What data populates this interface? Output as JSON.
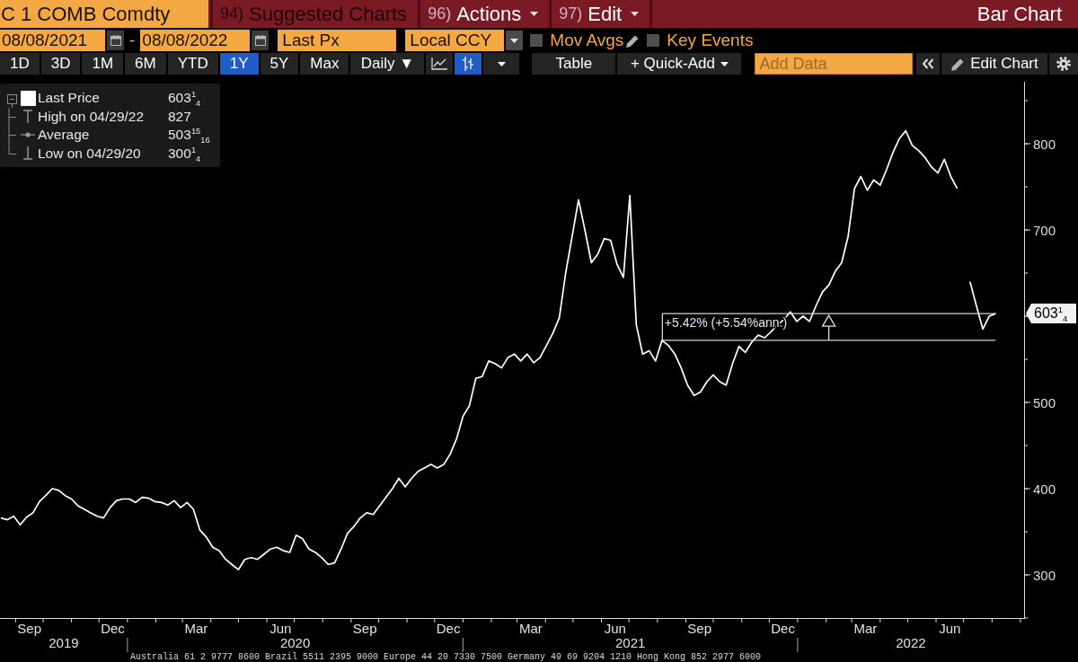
{
  "header": {
    "security": "C 1 COMB Comdty",
    "menus": [
      {
        "number": "94)",
        "label": "Suggested Charts",
        "disabled": true,
        "has_menu": false
      },
      {
        "number": "96)",
        "label": "Actions",
        "disabled": false,
        "has_menu": true
      },
      {
        "number": "97)",
        "label": "Edit",
        "disabled": false,
        "has_menu": true
      }
    ],
    "title": "Bar Chart"
  },
  "settings_bar": {
    "start_date": "08/08/2021",
    "date_separator": "-",
    "end_date": "08/08/2022",
    "field": "Last Px",
    "currency": "Local CCY",
    "toggles": [
      {
        "label": "Mov Avgs",
        "checked": false,
        "editable": true
      },
      {
        "label": "Key Events",
        "checked": false,
        "editable": false
      }
    ]
  },
  "toolbar": {
    "periods": [
      {
        "label": "1D",
        "selected": false
      },
      {
        "label": "3D",
        "selected": false
      },
      {
        "label": "1M",
        "selected": false
      },
      {
        "label": "6M",
        "selected": false
      },
      {
        "label": "YTD",
        "selected": false
      },
      {
        "label": "1Y",
        "selected": true
      },
      {
        "label": "5Y",
        "selected": false
      },
      {
        "label": "Max",
        "selected": false
      }
    ],
    "frequency": "Daily ▼",
    "chart_styles": [
      {
        "kind": "line",
        "selected": false
      },
      {
        "kind": "bar",
        "selected": true
      }
    ],
    "table_button": "Table",
    "quick_add": "+ Quick-Add",
    "add_data": {
      "placeholder": "Add Data"
    },
    "edit_chart": "Edit Chart"
  },
  "chart": {
    "legend": {
      "expanded": true,
      "items": [
        {
          "kind": "series",
          "label": "Last Price",
          "value": "603$^{1}$$_{4}$"
        },
        {
          "kind": "high",
          "label": "High on 04/29/22",
          "value": "827"
        },
        {
          "kind": "average",
          "label": "Average",
          "value": "503$^{15}$$_{16}$"
        },
        {
          "kind": "low",
          "label": "Low on 04/29/20",
          "value": "300$^{1}$$_{4}$"
        }
      ]
    },
    "last_price_tag": "603$^{1}$$_{4}$",
    "year_labels": [
      "2019",
      "2020",
      "2021",
      "2022"
    ],
    "chart_data": {
      "type": "line",
      "x": [
        "2019-08-16",
        "2019-08-23",
        "2019-08-30",
        "2019-09-06",
        "2019-09-13",
        "2019-09-20",
        "2019-09-27",
        "2019-10-04",
        "2019-10-11",
        "2019-10-18",
        "2019-10-25",
        "2019-11-01",
        "2019-11-08",
        "2019-11-15",
        "2019-11-22",
        "2019-11-29",
        "2019-12-06",
        "2019-12-13",
        "2019-12-20",
        "2019-12-27",
        "2020-01-03",
        "2020-01-10",
        "2020-01-17",
        "2020-01-24",
        "2020-01-31",
        "2020-02-07",
        "2020-02-14",
        "2020-02-21",
        "2020-02-28",
        "2020-03-06",
        "2020-03-13",
        "2020-03-20",
        "2020-03-27",
        "2020-04-03",
        "2020-04-10",
        "2020-04-17",
        "2020-04-24",
        "2020-05-01",
        "2020-05-08",
        "2020-05-15",
        "2020-05-22",
        "2020-05-29",
        "2020-06-05",
        "2020-06-12",
        "2020-06-19",
        "2020-06-26",
        "2020-07-03",
        "2020-07-10",
        "2020-07-17",
        "2020-07-24",
        "2020-07-31",
        "2020-08-07",
        "2020-08-14",
        "2020-08-21",
        "2020-08-28",
        "2020-09-04",
        "2020-09-11",
        "2020-09-18",
        "2020-09-25",
        "2020-10-02",
        "2020-10-09",
        "2020-10-16",
        "2020-10-23",
        "2020-10-30",
        "2020-11-06",
        "2020-11-13",
        "2020-11-20",
        "2020-11-27",
        "2020-12-04",
        "2020-12-11",
        "2020-12-18",
        "2020-12-25",
        "2021-01-01",
        "2021-01-08",
        "2021-01-15",
        "2021-01-22",
        "2021-01-29",
        "2021-02-05",
        "2021-02-12",
        "2021-02-19",
        "2021-02-26",
        "2021-03-05",
        "2021-03-12",
        "2021-03-19",
        "2021-03-26",
        "2021-04-02",
        "2021-04-09",
        "2021-04-16",
        "2021-04-23",
        "2021-04-30",
        "2021-05-07",
        "2021-05-14",
        "2021-05-21",
        "2021-05-28",
        "2021-06-04",
        "2021-06-11",
        "2021-06-18",
        "2021-06-25",
        "2021-07-02",
        "2021-07-09",
        "2021-07-16",
        "2021-07-23",
        "2021-07-30",
        "2021-08-06",
        "2021-08-13",
        "2021-08-20",
        "2021-08-27",
        "2021-09-03",
        "2021-09-10",
        "2021-09-17",
        "2021-09-24",
        "2021-10-01",
        "2021-10-08",
        "2021-10-15",
        "2021-10-22",
        "2021-10-29",
        "2021-11-05",
        "2021-11-12",
        "2021-11-19",
        "2021-11-26",
        "2021-12-03",
        "2021-12-10",
        "2021-12-17",
        "2021-12-24",
        "2021-12-31",
        "2022-01-07",
        "2022-01-14",
        "2022-01-21",
        "2022-01-28",
        "2022-02-04",
        "2022-02-11",
        "2022-02-18",
        "2022-02-25",
        "2022-03-04",
        "2022-03-11",
        "2022-03-18",
        "2022-03-25",
        "2022-04-01",
        "2022-04-08",
        "2022-04-15",
        "2022-04-22",
        "2022-04-29",
        "2022-05-06",
        "2022-05-13",
        "2022-05-20",
        "2022-05-27",
        "2022-06-03",
        "2022-06-10",
        "2022-06-17",
        "2022-06-24",
        "2022-07-01",
        "2022-07-08",
        "2022-07-15",
        "2022-07-22",
        "2022-07-29",
        "2022-08-05"
      ],
      "series": [
        {
          "color": "#ffffff",
          "values": [
            366,
            364,
            368,
            358,
            367,
            372,
            385,
            392,
            400,
            398,
            392,
            388,
            380,
            376,
            372,
            368,
            366,
            378,
            386,
            388,
            388,
            384,
            390,
            389,
            385,
            384,
            381,
            386,
            378,
            384,
            376,
            352,
            344,
            332,
            328,
            318,
            312,
            306,
            318,
            320,
            318,
            324,
            330,
            332,
            328,
            326,
            346,
            342,
            330,
            326,
            320,
            312,
            314,
            330,
            348,
            356,
            366,
            372,
            370,
            380,
            390,
            400,
            412,
            402,
            412,
            420,
            424,
            428,
            424,
            428,
            440,
            458,
            484,
            496,
            528,
            530,
            548,
            545,
            540,
            552,
            556,
            548,
            556,
            546,
            552,
            566,
            580,
            598,
            650,
            692,
            735,
            700,
            662,
            672,
            690,
            688,
            660,
            645,
            740,
            590,
            556,
            560,
            548,
            572,
            566,
            556,
            540,
            520,
            508,
            512,
            524,
            532,
            524,
            520,
            545,
            565,
            558,
            570,
            578,
            575,
            582,
            590,
            596,
            605,
            594,
            600,
            594,
            612,
            628,
            636,
            652,
            662,
            692,
            748,
            762,
            746,
            758,
            752,
            770,
            790,
            806,
            815,
            798,
            792,
            784,
            773,
            766,
            782,
            762,
            748,
            null,
            640,
            612,
            585,
            600,
            603
          ]
        }
      ],
      "xlim": [
        "2019-08-15",
        "2022-09-05"
      ],
      "ylim": [
        250,
        875
      ],
      "xticks": [
        {
          "value": "2019-09-16",
          "label": "Sep"
        },
        {
          "value": "2019-12-16",
          "label": "Dec"
        },
        {
          "value": "2020-03-16",
          "label": "Mar"
        },
        {
          "value": "2020-06-16",
          "label": "Jun"
        },
        {
          "value": "2020-09-16",
          "label": "Sep"
        },
        {
          "value": "2020-12-16",
          "label": "Dec"
        },
        {
          "value": "2021-03-16",
          "label": "Mar"
        },
        {
          "value": "2021-06-16",
          "label": "Jun"
        },
        {
          "value": "2021-09-16",
          "label": "Sep"
        },
        {
          "value": "2021-12-16",
          "label": "Dec"
        },
        {
          "value": "2022-03-16",
          "label": "Mar"
        },
        {
          "value": "2022-06-16",
          "label": "Jun"
        }
      ],
      "yticks": [
        300,
        400,
        500,
        700,
        800
      ],
      "annotations": [
        "+5.42% (+5.54%ann.)"
      ]
    }
  },
  "footer": "Australia 61 2 9777 8600 Brazil 5511 2395 9000 Europe 44 20 7330 7500 Germany 49 69 9204 1210 Hong Kong 852 2977 6000"
}
